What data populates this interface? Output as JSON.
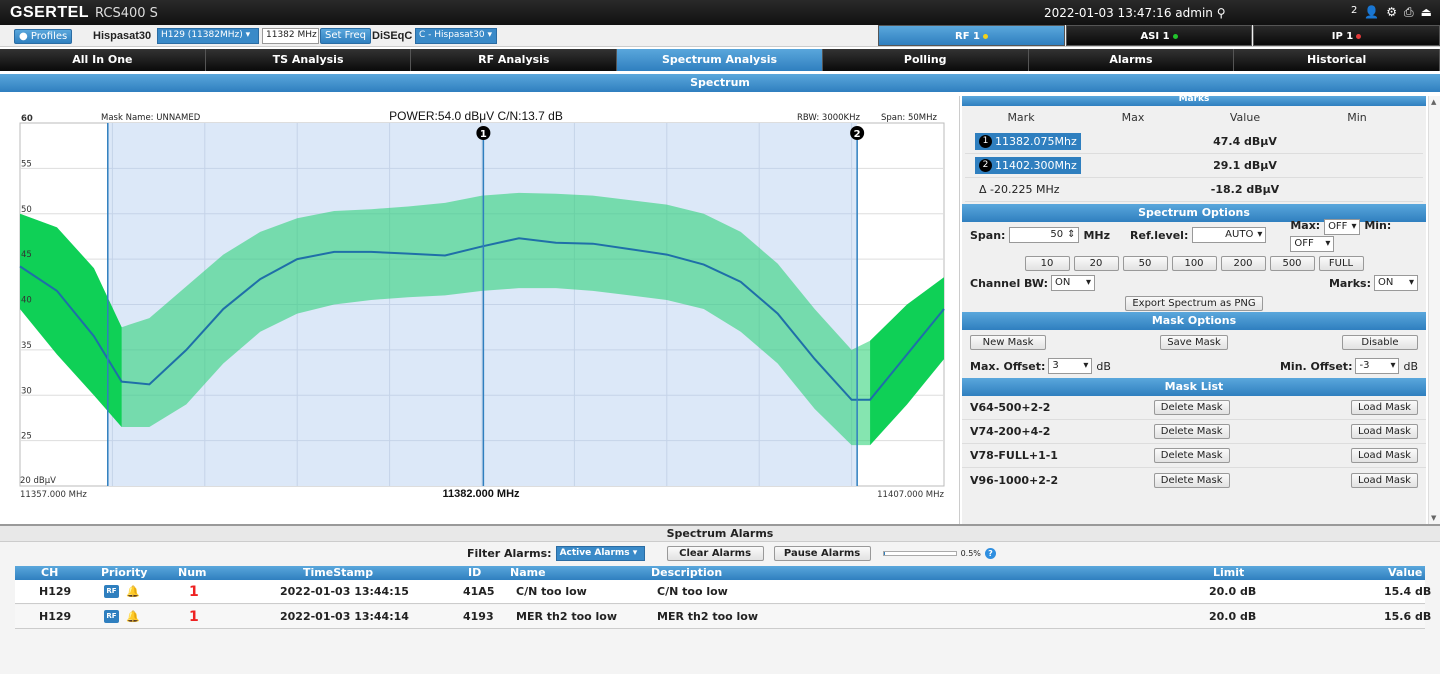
{
  "topbar": {
    "logo": "GSERTEL",
    "model": "RCS400 S",
    "datetime": "2022-01-03 13:47:16",
    "user": "admin",
    "notif_count": "2"
  },
  "toolbar": {
    "profiles_label": "Profiles",
    "satellite": "Hispasat30",
    "transponder": "H129 (11382MHz)",
    "freq_value": "11382 MHz",
    "set_freq_label": "Set Freq",
    "diseqc_label": "DiSEqC",
    "diseqc_value": "C - Hispasat30"
  },
  "status_tabs": [
    {
      "label": "RF 1",
      "color": "#f2d21b"
    },
    {
      "label": "ASI 1",
      "color": "#22c32c"
    },
    {
      "label": "IP 1",
      "color": "#e23a3a"
    }
  ],
  "nav": [
    "All In One",
    "TS Analysis",
    "RF Analysis",
    "Spectrum Analysis",
    "Polling",
    "Alarms",
    "Historical"
  ],
  "nav_active": 3,
  "section_title": "Spectrum",
  "spectrum": {
    "mask_name": "Mask Name: UNNAMED",
    "power_cn": "POWER:54.0 dBμV  C/N:13.7 dB",
    "rbw": "RBW: 3000KHz",
    "span": "Span: 50MHz",
    "x_left": "11357.000 MHz",
    "x_center": "11382.000 MHz",
    "x_right": "11407.000 MHz",
    "y_bottom_label": "20 dBμV"
  },
  "chart_data": {
    "type": "line",
    "x_range": [
      11357,
      11407
    ],
    "ylim": [
      20,
      60
    ],
    "yticks": [
      "60",
      "55",
      "50",
      "45",
      "40",
      "35",
      "30",
      "25"
    ],
    "markers": [
      {
        "id": "1",
        "freq": 11382.075
      },
      {
        "id": "2",
        "freq": 11402.3
      }
    ],
    "mask_range": [
      11361.75,
      11402.3
    ],
    "x": [
      11357,
      11359,
      11361,
      11362.5,
      11364,
      11366,
      11368,
      11370,
      11372,
      11374,
      11376,
      11378,
      11380,
      11382,
      11384,
      11386,
      11388,
      11390,
      11392,
      11394,
      11396,
      11398,
      11400,
      11402,
      11403,
      11405,
      11407
    ],
    "trace": [
      44.2,
      41.5,
      36.5,
      31.5,
      31.2,
      35.0,
      39.5,
      42.8,
      45.0,
      45.8,
      45.8,
      45.6,
      45.4,
      46.4,
      47.3,
      46.8,
      46.7,
      46.1,
      45.5,
      44.4,
      42.5,
      39.0,
      34.0,
      29.5,
      29.5,
      34.5,
      39.5
    ],
    "upper": [
      50.0,
      48.5,
      44.0,
      37.5,
      38.5,
      42.0,
      45.5,
      48.0,
      49.5,
      50.3,
      50.5,
      50.8,
      51.2,
      52.0,
      52.3,
      52.2,
      52.0,
      51.5,
      51.0,
      50.0,
      48.0,
      44.5,
      39.5,
      35.0,
      36.0,
      40.0,
      43.0
    ],
    "lower": [
      39.5,
      34.5,
      30.0,
      26.5,
      26.5,
      29.0,
      33.5,
      37.0,
      39.0,
      40.0,
      40.5,
      40.8,
      41.0,
      41.5,
      41.8,
      41.8,
      41.5,
      41.0,
      40.5,
      39.5,
      37.0,
      33.5,
      28.5,
      24.5,
      24.5,
      29.0,
      34.0
    ]
  },
  "marks": {
    "title": "Marks",
    "headers": [
      "Mark",
      "Max",
      "Value",
      "Min"
    ],
    "rows": [
      {
        "n": "1",
        "freq": "11382.075Mhz",
        "value": "47.4 dBμV"
      },
      {
        "n": "2",
        "freq": "11402.300Mhz",
        "value": "29.1 dBμV"
      }
    ],
    "delta_label": "Δ -20.225 MHz",
    "delta_value": "-18.2 dBμV"
  },
  "spectrum_options": {
    "title": "Spectrum Options",
    "span_label": "Span:",
    "span_value": "50",
    "span_unit": "MHz",
    "ref_label": "Ref.level:",
    "ref_value": "AUTO",
    "max_label": "Max:",
    "max_value": "OFF",
    "min_label": "Min:",
    "min_value": "OFF",
    "span_buttons": [
      "10",
      "20",
      "50",
      "100",
      "200",
      "500",
      "FULL"
    ],
    "chbw_label": "Channel BW:",
    "chbw_value": "ON",
    "marks_label": "Marks:",
    "marks_value": "ON",
    "export_label": "Export Spectrum as PNG"
  },
  "mask_options": {
    "title": "Mask Options",
    "new_label": "New Mask",
    "save_label": "Save Mask",
    "disable_label": "Disable",
    "max_offset_label": "Max. Offset:",
    "max_offset_value": "3",
    "min_offset_label": "Min. Offset:",
    "min_offset_value": "-3",
    "unit": "dB"
  },
  "mask_list": {
    "title": "Mask List",
    "delete_label": "Delete Mask",
    "load_label": "Load Mask",
    "items": [
      "V64-500+2-2",
      "V74-200+4-2",
      "V78-FULL+1-1",
      "V96-1000+2-2"
    ]
  },
  "alarms": {
    "title": "Spectrum Alarms",
    "filter_label": "Filter Alarms:",
    "filter_value": "Active Alarms",
    "clear_label": "Clear Alarms",
    "pause_label": "Pause Alarms",
    "progress_text": "0.5%",
    "progress_value": 0.005,
    "headers": [
      "CH",
      "Priority",
      "Num",
      "TimeStamp",
      "ID",
      "Name",
      "Description",
      "Limit",
      "Value"
    ],
    "rows": [
      {
        "ch": "H129",
        "num": "1",
        "timestamp": "2022-01-03 13:44:15",
        "id": "41A5",
        "name": "C/N too low",
        "desc": "C/N too low",
        "limit": "20.0 dB",
        "value": "15.4 dB"
      },
      {
        "ch": "H129",
        "num": "1",
        "timestamp": "2022-01-03 13:44:14",
        "id": "4193",
        "name": "MER th2 too low",
        "desc": "MER th2 too low",
        "limit": "20.0 dB",
        "value": "15.6 dB"
      }
    ]
  }
}
